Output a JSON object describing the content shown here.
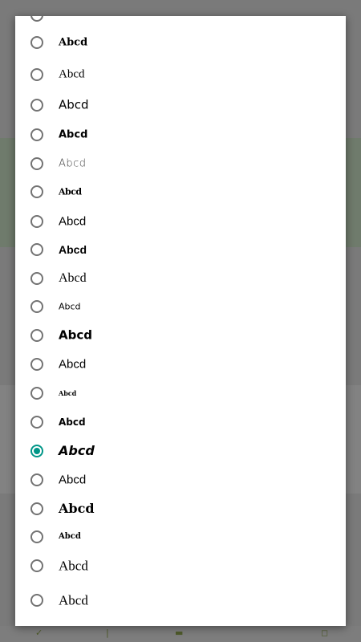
{
  "accent_color": "#009688",
  "font_options": [
    {
      "label": "Abcd",
      "selected": false
    },
    {
      "label": "Abcd",
      "selected": false
    },
    {
      "label": "Abcd",
      "selected": false
    },
    {
      "label": "Abcd",
      "selected": false
    },
    {
      "label": "Abcd",
      "selected": false
    },
    {
      "label": "Abcd",
      "selected": false
    },
    {
      "label": "Abcd",
      "selected": false
    },
    {
      "label": "Abcd",
      "selected": false
    },
    {
      "label": "Abcd",
      "selected": false
    },
    {
      "label": "Abcd",
      "selected": false
    },
    {
      "label": "Abcd",
      "selected": false
    },
    {
      "label": "Abcd",
      "selected": false
    },
    {
      "label": "Abcd",
      "selected": false
    },
    {
      "label": "Abcd",
      "selected": false
    },
    {
      "label": "Abcd",
      "selected": true
    },
    {
      "label": "Abcd",
      "selected": false
    },
    {
      "label": "Abcd",
      "selected": false
    },
    {
      "label": "Abcd",
      "selected": false
    },
    {
      "label": "Abcd",
      "selected": false
    },
    {
      "label": "Abcd",
      "selected": false
    }
  ]
}
